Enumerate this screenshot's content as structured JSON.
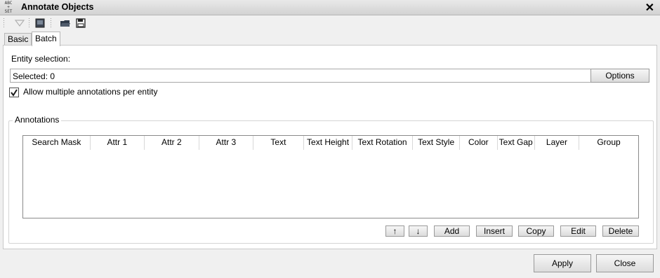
{
  "window": {
    "title": "Annotate Objects",
    "app_icon_text": "ABC SET"
  },
  "toolbar": {
    "icons": [
      "filter-icon",
      "screen-icon",
      "open-folder-icon",
      "save-icon"
    ]
  },
  "tabs": [
    {
      "label": "Basic",
      "active": false
    },
    {
      "label": "Batch",
      "active": true
    }
  ],
  "entity": {
    "label": "Entity selection:",
    "selected_value": "Selected: 0",
    "options_label": "Options"
  },
  "allow_multiple": {
    "label": "Allow multiple annotations per entity",
    "checked": true
  },
  "annotations": {
    "group_label": "Annotations",
    "columns": [
      "Search Mask",
      "Attr 1",
      "Attr 2",
      "Attr 3",
      "Text",
      "Text Height",
      "Text Rotation",
      "Text Style",
      "Color",
      "Text Gap",
      "Layer",
      "Group"
    ],
    "rows": []
  },
  "actions": {
    "up": "↑",
    "down": "↓",
    "add": "Add",
    "insert": "Insert",
    "copy": "Copy",
    "edit": "Edit",
    "delete": "Delete"
  },
  "footer": {
    "apply": "Apply",
    "close": "Close"
  }
}
